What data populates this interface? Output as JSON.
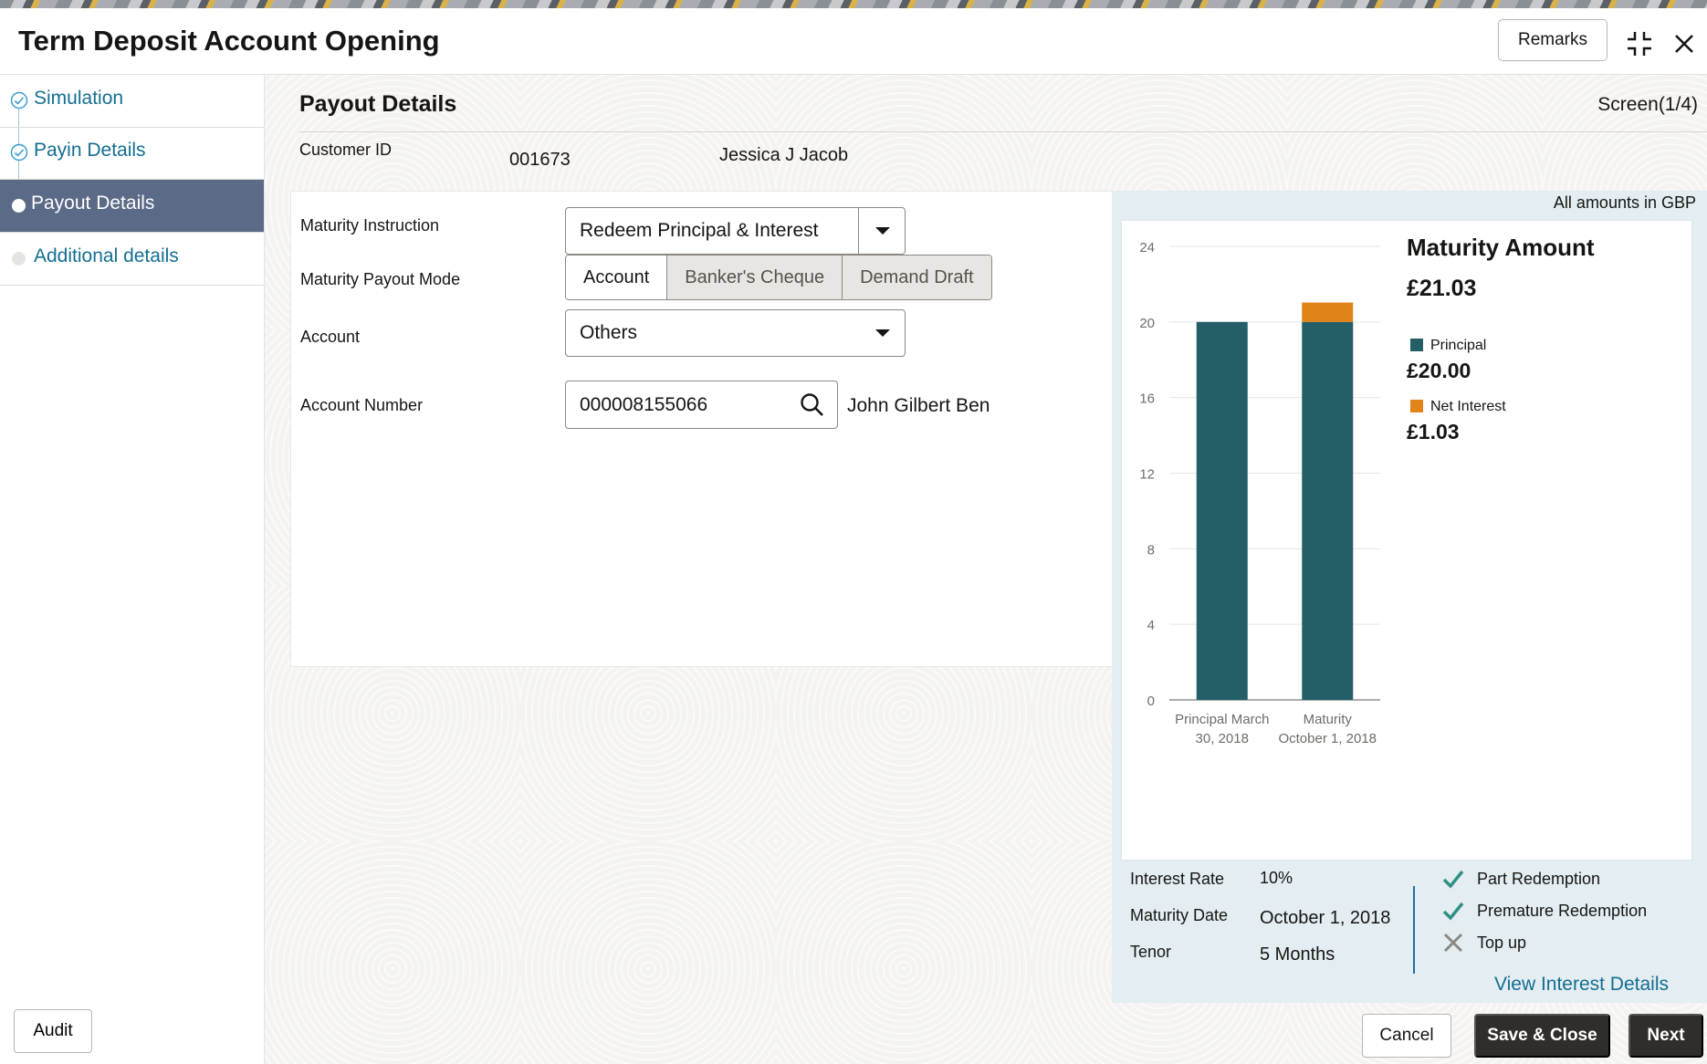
{
  "window": {
    "title": "Term Deposit Account Opening",
    "remarks_label": "Remarks"
  },
  "sidebar": {
    "steps": [
      {
        "label": "Simulation",
        "state": "complete"
      },
      {
        "label": "Payin Details",
        "state": "complete"
      },
      {
        "label": "Payout Details",
        "state": "active"
      },
      {
        "label": "Additional details",
        "state": "pending"
      }
    ],
    "audit_label": "Audit"
  },
  "main": {
    "section_title": "Payout Details",
    "screen_indicator": "Screen(1/4)",
    "customer": {
      "label": "Customer ID",
      "id": "001673",
      "name": "Jessica J Jacob"
    },
    "form": {
      "maturity_instruction_label": "Maturity Instruction",
      "maturity_instruction_value": "Redeem Principal & Interest",
      "payout_mode_label": "Maturity Payout Mode",
      "payout_modes": [
        "Account",
        "Banker's Cheque",
        "Demand Draft"
      ],
      "payout_mode_selected": "Account",
      "account_label": "Account",
      "account_value": "Others",
      "account_number_label": "Account Number",
      "account_number_value": "000008155066",
      "account_holder": "John Gilbert Ben"
    }
  },
  "summary": {
    "currency_note": "All amounts in GBP",
    "maturity_title": "Maturity Amount",
    "maturity_total": "£21.03",
    "legend": [
      {
        "label": "Principal",
        "value": "£20.00",
        "color": "#245f68"
      },
      {
        "label": "Net Interest",
        "value": "£1.03",
        "color": "#e0841a"
      }
    ],
    "info": {
      "interest_rate_label": "Interest Rate",
      "interest_rate_value": "10%",
      "maturity_date_label": "Maturity Date",
      "maturity_date_value": "October 1, 2018",
      "tenor_label": "Tenor",
      "tenor_value": "5 Months"
    },
    "features": [
      {
        "label": "Part Redemption",
        "enabled": true
      },
      {
        "label": "Premature Redemption",
        "enabled": true
      },
      {
        "label": "Top up",
        "enabled": false
      }
    ],
    "view_link": "View Interest Details"
  },
  "footer": {
    "cancel_label": "Cancel",
    "save_close_label": "Save & Close",
    "next_label": "Next"
  },
  "chart_data": {
    "type": "bar",
    "stacked": true,
    "categories": [
      [
        "Principal March",
        "30, 2018"
      ],
      [
        "Maturity",
        "October 1, 2018"
      ]
    ],
    "series": [
      {
        "name": "Principal",
        "values": [
          20,
          20
        ],
        "color": "#245f68"
      },
      {
        "name": "Net Interest",
        "values": [
          0,
          1.03
        ],
        "color": "#e0841a"
      }
    ],
    "yticks": [
      0,
      4,
      8,
      12,
      16,
      20,
      24
    ],
    "ylim": [
      0,
      24
    ],
    "grid": true
  }
}
